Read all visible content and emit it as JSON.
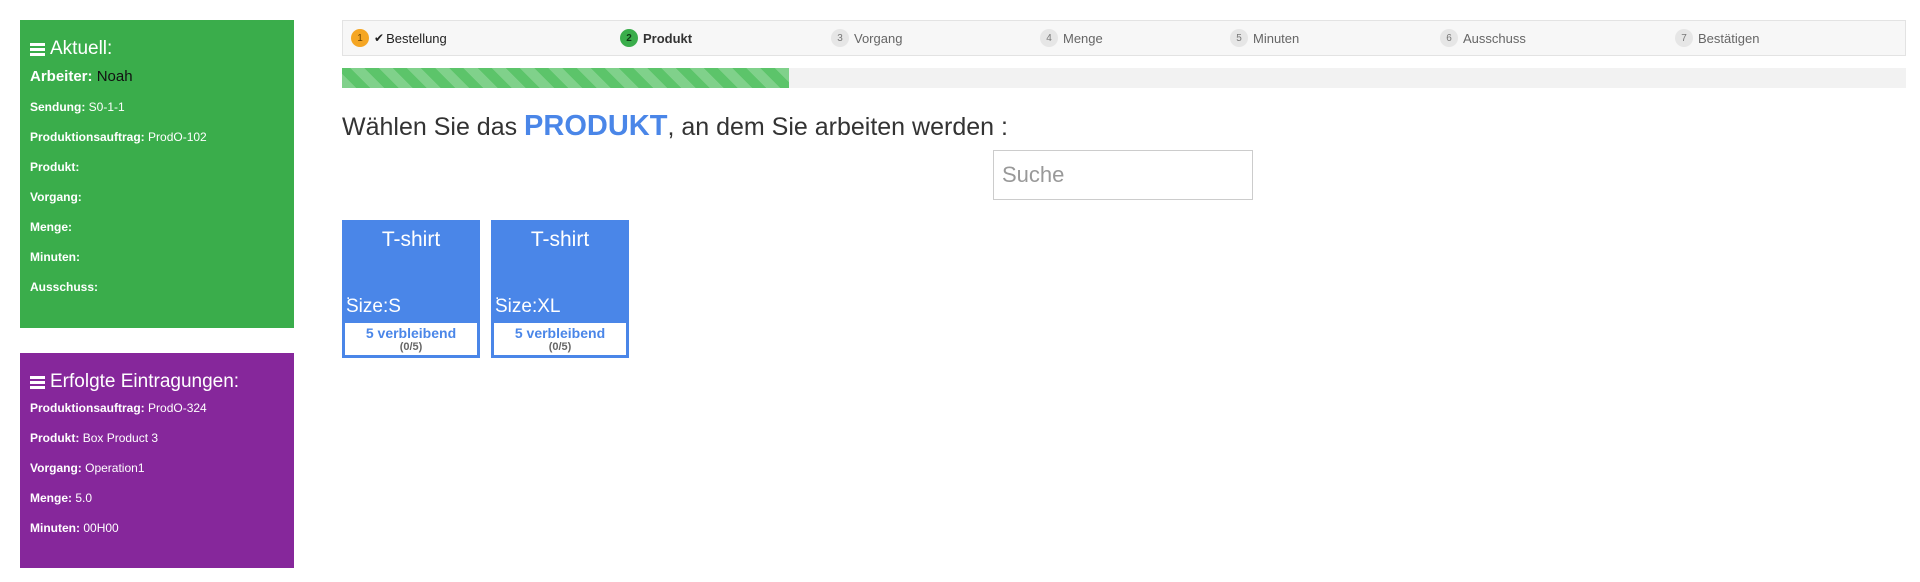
{
  "current": {
    "title": "Aktuell:",
    "worker_label": "Arbeiter:",
    "worker_value": "Noah",
    "rows": [
      {
        "label": "Sendung:",
        "value": "S0-1-1"
      },
      {
        "label": "Produktionsauftrag:",
        "value": "ProdO-102"
      },
      {
        "label": "Produkt:",
        "value": ""
      },
      {
        "label": "Vorgang:",
        "value": ""
      },
      {
        "label": "Menge:",
        "value": ""
      },
      {
        "label": "Minuten:",
        "value": ""
      },
      {
        "label": "Ausschuss:",
        "value": ""
      }
    ]
  },
  "done": {
    "title": "Erfolgte Eintragungen:",
    "rows": [
      {
        "label": "Produktionsauftrag:",
        "value": "ProdO-324"
      },
      {
        "label": "Produkt:",
        "value": "Box Product 3"
      },
      {
        "label": "Vorgang:",
        "value": "Operation1"
      },
      {
        "label": "Menge:",
        "value": "5.0"
      },
      {
        "label": "Minuten:",
        "value": "00H00"
      }
    ]
  },
  "steps": [
    {
      "num": "1",
      "label": "Bestellung",
      "state": "done"
    },
    {
      "num": "2",
      "label": "Produkt",
      "state": "active"
    },
    {
      "num": "3",
      "label": "Vorgang",
      "state": "pending"
    },
    {
      "num": "4",
      "label": "Menge",
      "state": "pending"
    },
    {
      "num": "5",
      "label": "Minuten",
      "state": "pending"
    },
    {
      "num": "6",
      "label": "Ausschuss",
      "state": "pending"
    },
    {
      "num": "7",
      "label": "Bestätigen",
      "state": "pending"
    }
  ],
  "progress_percent": 28.6,
  "heading": {
    "before": "Wählen Sie das ",
    "emphasis": "PRODUKT",
    "after": ", an dem Sie arbeiten werden :"
  },
  "search": {
    "placeholder": "Suche",
    "value": ""
  },
  "products": [
    {
      "name": "T-shirt",
      "dot": ".",
      "variant": "Size:S",
      "remaining": "5 verbleibend",
      "ratio": "(0/5)"
    },
    {
      "name": "T-shirt",
      "dot": ".",
      "variant": "Size:XL",
      "remaining": "5 verbleibend",
      "ratio": "(0/5)"
    }
  ],
  "colors": {
    "current_panel": "#3aad4b",
    "done_panel": "#86279b",
    "accent": "#4a86e8",
    "step_done": "#f5a623",
    "step_active": "#3aad4b"
  }
}
